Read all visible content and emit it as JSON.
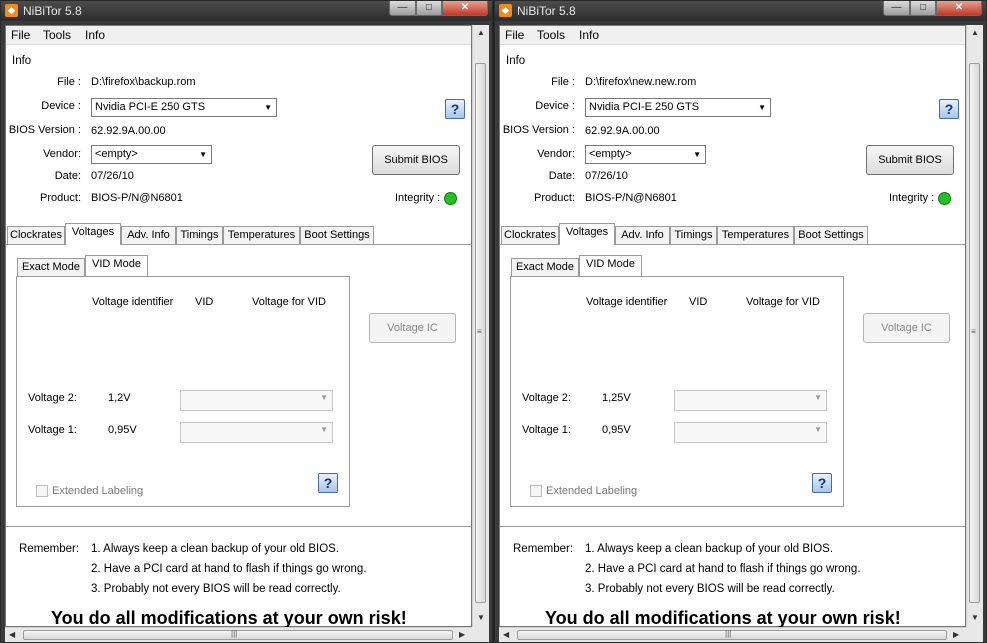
{
  "app_title": "NiBiTor 5.8",
  "window_controls": {
    "minimize": "—",
    "maximize": "□",
    "close": "✕"
  },
  "menu": [
    "File",
    "Tools",
    "Info"
  ],
  "info_group": "Info",
  "labels": {
    "file": "File :",
    "device": "Device :",
    "bios_version": "BIOS Version :",
    "vendor": "Vendor:",
    "date": "Date:",
    "product": "Product:",
    "integrity": "Integrity :"
  },
  "buttons": {
    "submit_bios": "Submit BIOS",
    "voltage_ic": "Voltage IC",
    "help": "?"
  },
  "tabs": [
    "Clockrates",
    "Voltages",
    "Adv. Info",
    "Timings",
    "Temperatures",
    "Boot Settings"
  ],
  "subtabs": [
    "Exact Mode",
    "VID Mode"
  ],
  "vid_headers": {
    "identifier": "Voltage identifier",
    "vid": "VID",
    "voltage_for_vid": "Voltage for VID"
  },
  "voltage_labels": {
    "v2": "Voltage 2:",
    "v1": "Voltage 1:"
  },
  "extended_labeling": "Extended Labeling",
  "remember": {
    "label": "Remember:",
    "lines": [
      "1. Always keep a clean backup of your old BIOS.",
      "2. Have a PCI card at hand to flash if things go wrong.",
      "3. Probably not every BIOS will be read correctly."
    ]
  },
  "risk_text": "You do all modifications at your own risk!",
  "integrity_color": "#22c022",
  "windows": [
    {
      "file": "D:\\firefox\\backup.rom",
      "device": "Nvidia PCI-E 250 GTS",
      "bios_version": "62.92.9A.00.00",
      "vendor": "<empty>",
      "date": "07/26/10",
      "product": "BIOS-P/N@N6801",
      "voltage2": "1,2V",
      "voltage1": "0,95V"
    },
    {
      "file": "D:\\firefox\\new.new.rom",
      "device": "Nvidia PCI-E 250 GTS",
      "bios_version": "62.92.9A.00.00",
      "vendor": "<empty>",
      "date": "07/26/10",
      "product": "BIOS-P/N@N6801",
      "voltage2": "1,25V",
      "voltage1": "0,95V"
    }
  ]
}
